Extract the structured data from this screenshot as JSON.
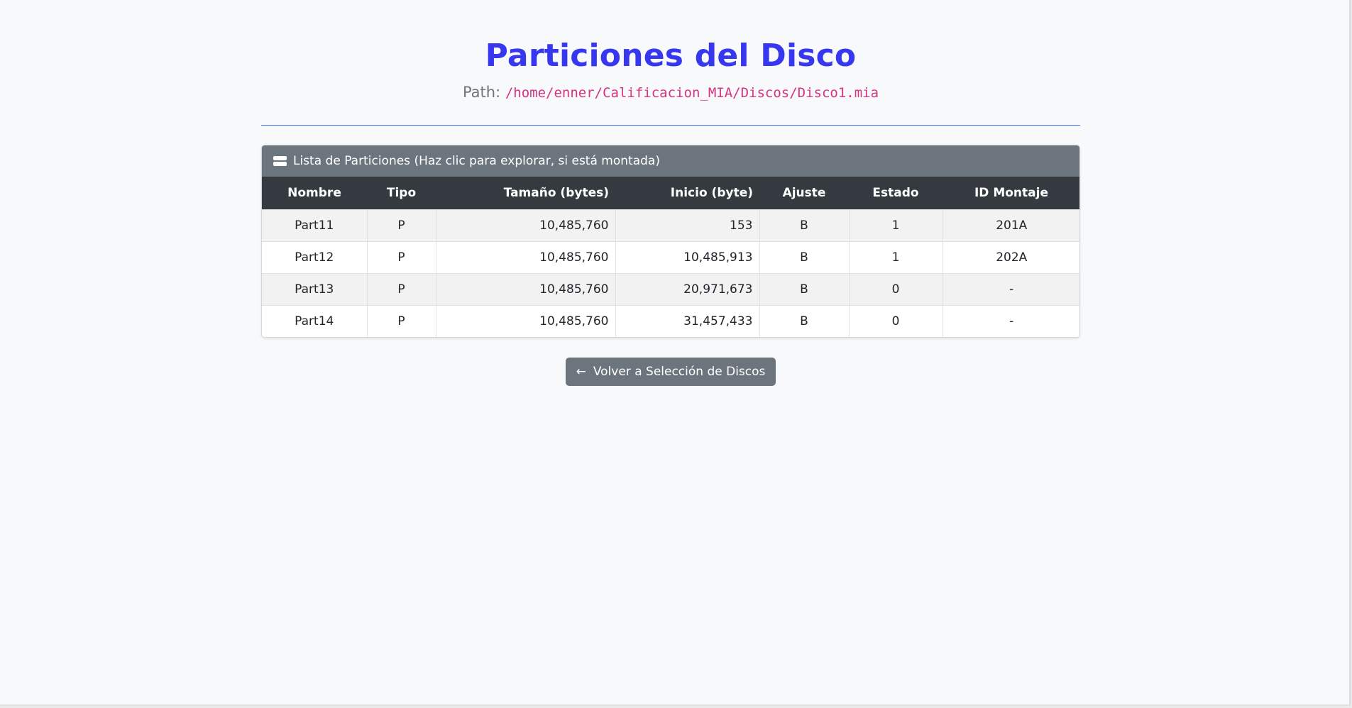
{
  "page": {
    "title": "Particiones del Disco",
    "path_label": "Path:",
    "path_value": "/home/enner/Calificacion_MIA/Discos/Disco1.mia"
  },
  "card": {
    "icon": "hdd-stack-icon",
    "header": "Lista de Particiones (Haz clic para explorar, si está montada)"
  },
  "table": {
    "columns": [
      "Nombre",
      "Tipo",
      "Tamaño (bytes)",
      "Inicio (byte)",
      "Ajuste",
      "Estado",
      "ID Montaje"
    ],
    "rows": [
      [
        "Part11",
        "P",
        "10,485,760",
        "153",
        "B",
        "1",
        "201A"
      ],
      [
        "Part12",
        "P",
        "10,485,760",
        "10,485,913",
        "B",
        "1",
        "202A"
      ],
      [
        "Part13",
        "P",
        "10,485,760",
        "20,971,673",
        "B",
        "0",
        "-"
      ],
      [
        "Part14",
        "P",
        "10,485,760",
        "31,457,433",
        "B",
        "0",
        "-"
      ]
    ]
  },
  "actions": {
    "back_icon": "arrow-left-icon",
    "back_arrow": "←",
    "back_label": "Volver a Selección de Discos"
  },
  "colors": {
    "title": "#3737f0",
    "path": "#d63384",
    "card_header": "#6c757d",
    "table_head": "#343a40",
    "divider": "#3d6df0",
    "button": "#6c757d"
  }
}
